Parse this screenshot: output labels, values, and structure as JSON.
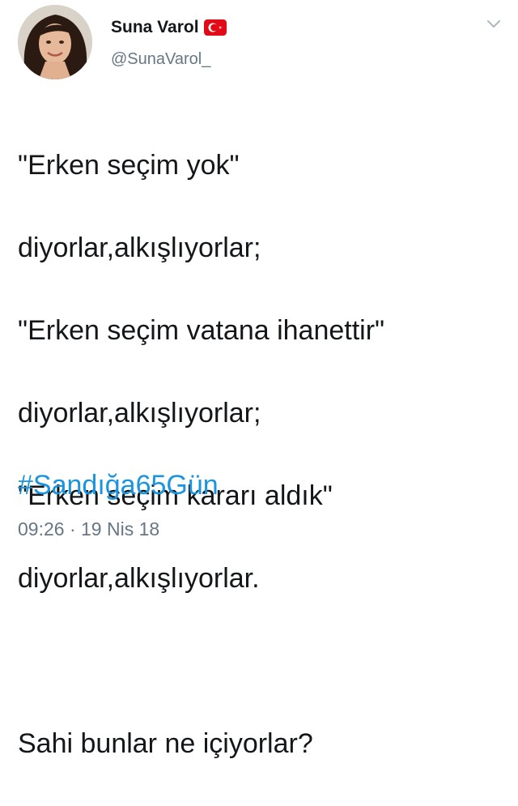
{
  "author": {
    "display_name": "Suna Varol",
    "handle": "@SunaVarol_",
    "badge_icon": "turkey-flag-icon"
  },
  "tweet": {
    "lines": [
      "\"Erken seçim yok\"",
      "diyorlar,alkışlıyorlar;",
      "\"Erken seçim vatana ihanettir\"",
      "diyorlar,alkışlıyorlar;",
      "\"Erken seçim kararı aldık\"",
      "diyorlar,alkışlıyorlar.",
      "",
      "Sahi bunlar ne içiyorlar?"
    ],
    "hashtag": "#Sandığa65Gün",
    "timestamp": "09:26 · 19 Nis 18"
  },
  "menu_icon": "chevron-down-icon",
  "colors": {
    "hashtag": "#1b95e0",
    "secondary_text": "#657786",
    "flag_red": "#e30a17"
  }
}
